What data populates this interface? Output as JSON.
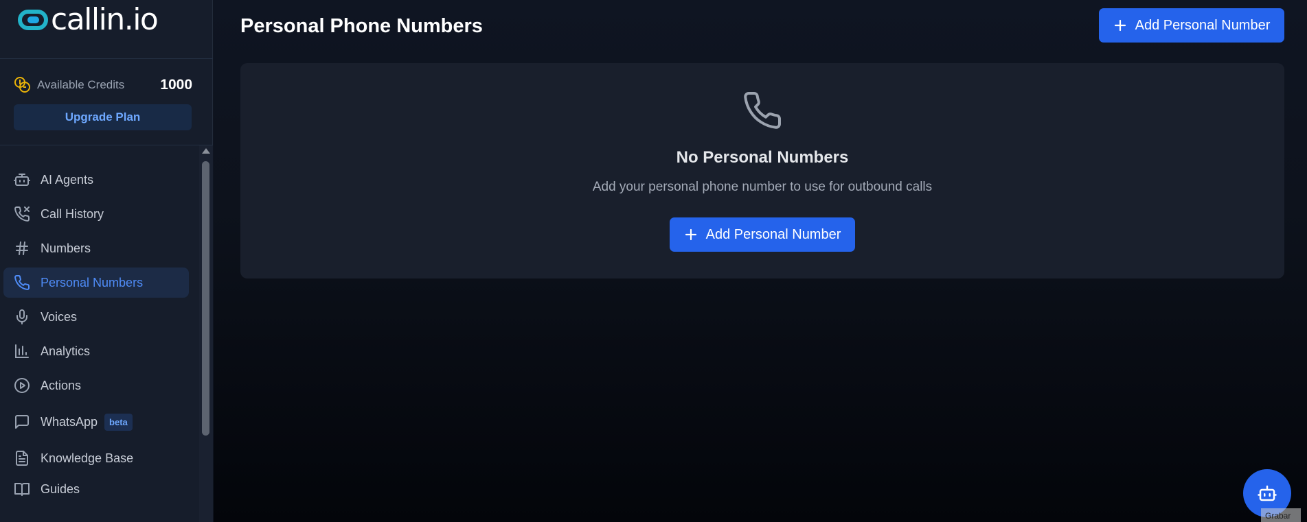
{
  "app": {
    "logo_text": "callin.io"
  },
  "credits": {
    "label": "Available Credits",
    "value": "1000"
  },
  "upgrade": {
    "label": "Upgrade Plan"
  },
  "nav": {
    "items": [
      {
        "label": "AI Agents",
        "icon": "robot-icon"
      },
      {
        "label": "Call History",
        "icon": "phone-history-icon"
      },
      {
        "label": "Numbers",
        "icon": "hash-icon"
      },
      {
        "label": "Personal Numbers",
        "icon": "phone-icon",
        "active": true
      },
      {
        "label": "Voices",
        "icon": "microphone-icon"
      },
      {
        "label": "Analytics",
        "icon": "bar-chart-icon"
      },
      {
        "label": "Actions",
        "icon": "play-circle-icon"
      },
      {
        "label": "WhatsApp",
        "icon": "chat-icon",
        "badge": "beta"
      },
      {
        "label": "Knowledge Base",
        "icon": "document-icon"
      },
      {
        "label": "Guides",
        "icon": "book-icon"
      }
    ]
  },
  "page": {
    "title": "Personal Phone Numbers",
    "add_button_label": "Add Personal Number"
  },
  "empty_state": {
    "title": "No Personal Numbers",
    "subtitle": "Add your personal phone number to use for outbound calls",
    "button_label": "Add Personal Number"
  },
  "overlay": {
    "grabar_label": "Grabar"
  },
  "colors": {
    "accent": "#2563eb",
    "active_nav": "#4f8cf7",
    "sidebar_bg": "#161d2b",
    "card_bg": "#191f2c"
  }
}
